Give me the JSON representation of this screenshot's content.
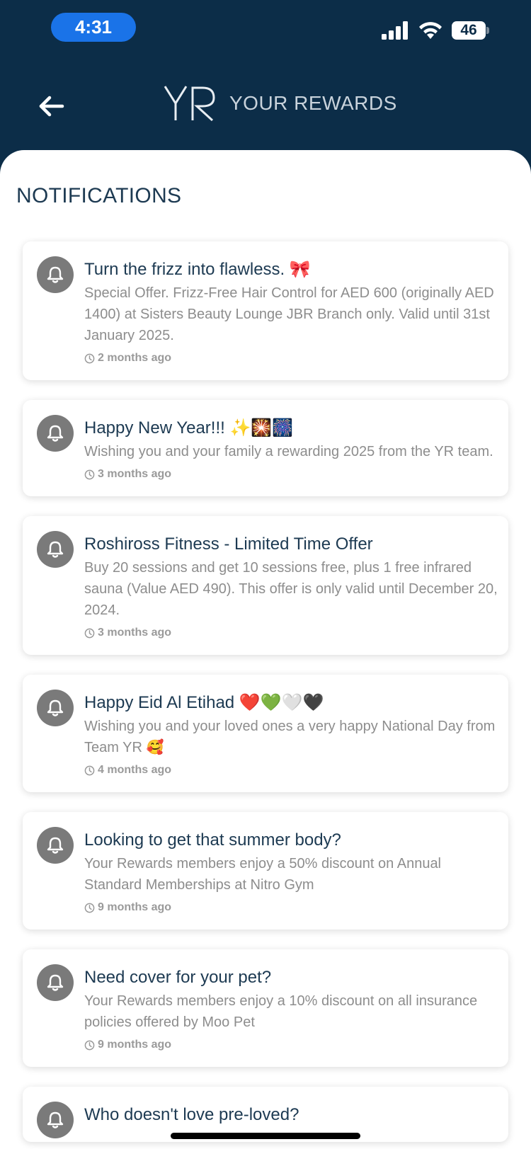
{
  "status_bar": {
    "time": "4:31",
    "battery": "46"
  },
  "header": {
    "brand": "YOUR REWARDS",
    "logo_text": "YR"
  },
  "page": {
    "title": "NOTIFICATIONS"
  },
  "notifications": [
    {
      "title": "Turn the frizz into flawless. 🎀",
      "body": "Special Offer. Frizz-Free Hair Control for AED 600 (originally AED 1400) at Sisters Beauty Lounge JBR Branch only. Valid until 31st January 2025.",
      "time": "2 months ago"
    },
    {
      "title": "Happy New Year!!! ✨🎇🎆",
      "body": "Wishing you and your family a rewarding 2025 from the YR team.",
      "time": "3 months ago"
    },
    {
      "title": "Roshiross Fitness - Limited Time Offer",
      "body": "Buy 20 sessions and get 10 sessions free, plus 1 free infrared sauna (Value AED 490). This offer is only valid until December 20, 2024.",
      "time": "3 months ago"
    },
    {
      "title": "Happy Eid Al Etihad ❤️💚🤍🖤",
      "body": "Wishing you and your loved ones a very happy National Day from Team YR 🥰",
      "time": "4 months ago"
    },
    {
      "title": "Looking to get that summer body?",
      "body": "Your Rewards members enjoy a 50% discount on Annual Standard Memberships at Nitro Gym",
      "time": "9 months ago"
    },
    {
      "title": "Need cover for your pet?",
      "body": "Your Rewards members enjoy a 10% discount on all insurance policies offered by Moo Pet",
      "time": "9 months ago"
    },
    {
      "title": "Who doesn't love pre-loved?",
      "body": "",
      "time": ""
    }
  ]
}
